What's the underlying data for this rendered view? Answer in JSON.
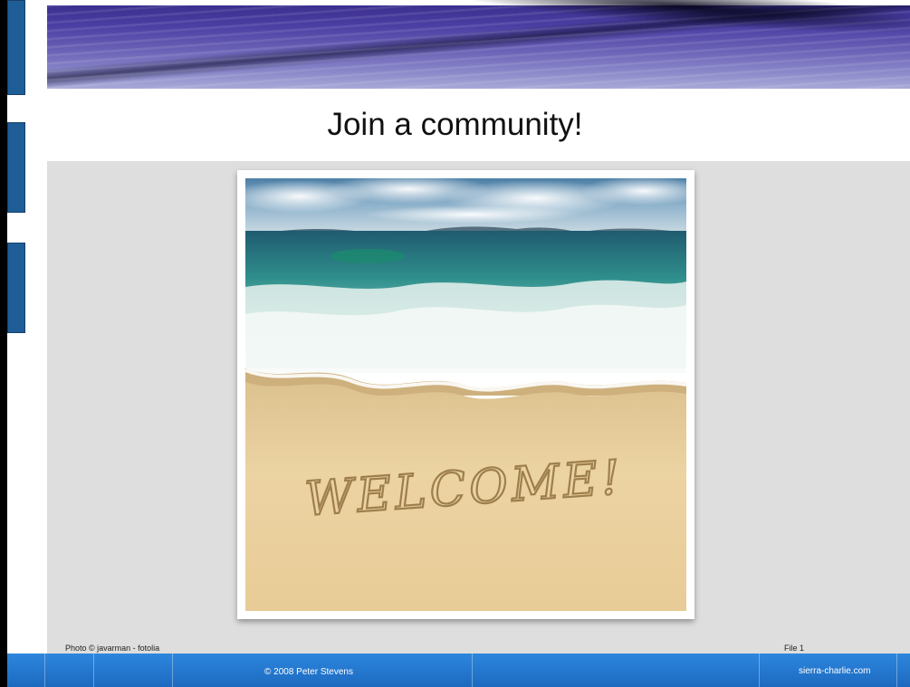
{
  "slide": {
    "title": "Join a community!",
    "photo_text": "WELCOME!",
    "photo_credit": "Photo © javarman - fotolia",
    "file_label": "File 1"
  },
  "footer": {
    "copyright": "© 2008 Peter Stevens",
    "site": "sierra-charlie.com"
  },
  "colors": {
    "accent": "#1f5d96",
    "footer": "#2476cf",
    "panel": "#dedede"
  }
}
